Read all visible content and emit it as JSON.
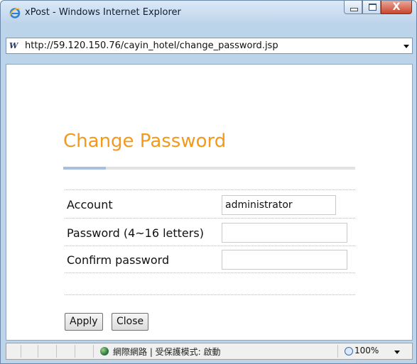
{
  "window": {
    "title": "xPost - Windows Internet Explorer",
    "close_glyph": "X"
  },
  "address_bar": {
    "url": "http://59.120.150.76/cayin_hotel/change_password.jsp",
    "site_icon_text": "W"
  },
  "page": {
    "title": "Change Password",
    "title_color": "#f29a1c",
    "fields": {
      "account_label": "Account",
      "account_value": "administrator",
      "password_label": "Password (4~16 letters)",
      "password_value": "",
      "confirm_label": "Confirm password",
      "confirm_value": ""
    },
    "buttons": {
      "apply": "Apply",
      "close": "Close"
    }
  },
  "status_bar": {
    "zone_text": "網際網路 | 受保護模式: 啟動",
    "zoom": "100%"
  }
}
